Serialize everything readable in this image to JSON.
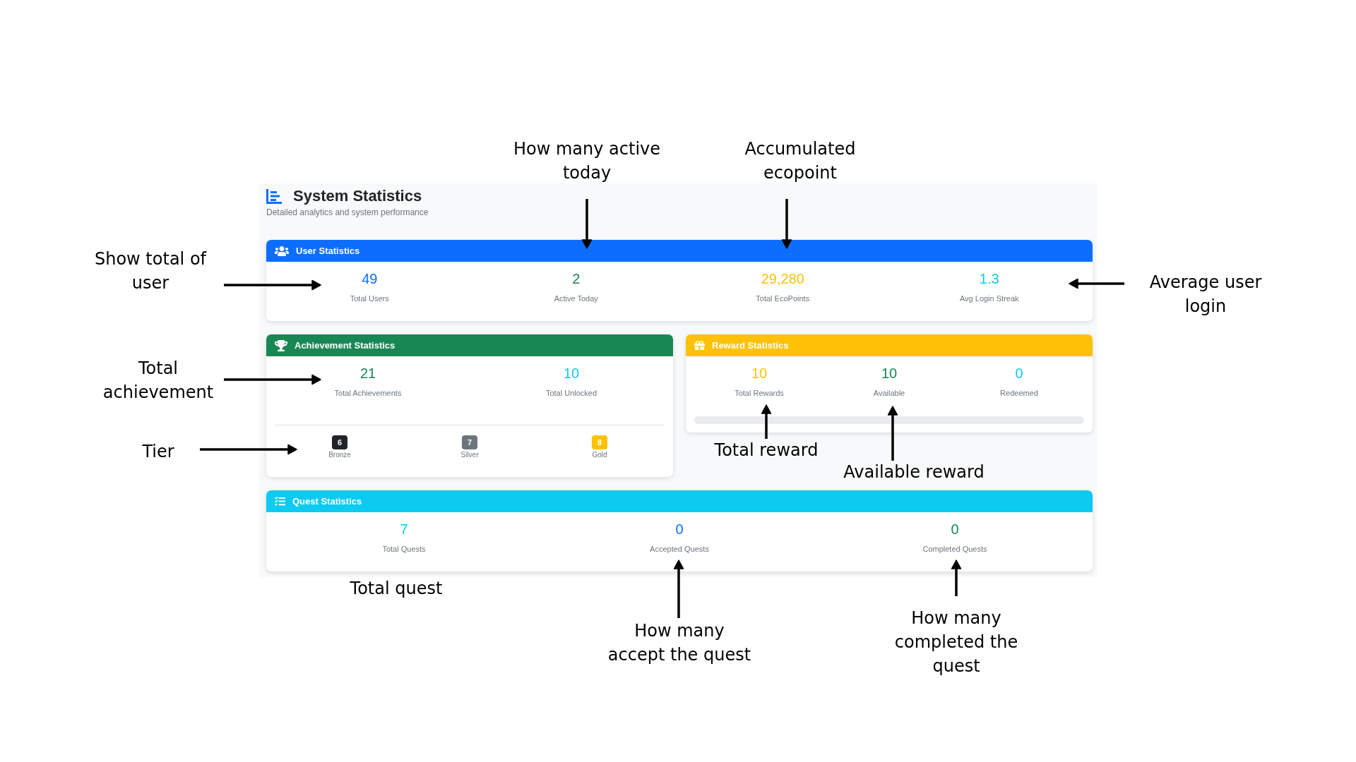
{
  "header": {
    "title": "System Statistics",
    "subtitle": "Detailed analytics and system performance"
  },
  "sections": [
    {
      "kind": "user",
      "title": "User Statistics",
      "color": "#0d6efd",
      "stats": [
        {
          "value": "49",
          "label": "Total Users",
          "color": "#0d6efd"
        },
        {
          "value": "2",
          "label": "Active Today",
          "color": "#198754"
        },
        {
          "value": "29,280",
          "label": "Total EcoPoints",
          "color": "#ffc107"
        },
        {
          "value": "1.3",
          "label": "Avg Login Streak",
          "color": "#0dcaf0"
        }
      ]
    },
    {
      "kind": "achievement",
      "title": "Achievement Statistics",
      "color": "#198754",
      "stats": [
        {
          "value": "21",
          "label": "Total Achievements",
          "color": "#198754"
        },
        {
          "value": "10",
          "label": "Total Unlocked",
          "color": "#0dcaf0"
        }
      ],
      "tiers": [
        {
          "count": "6",
          "label": "Bronze",
          "color": "#212529"
        },
        {
          "count": "7",
          "label": "Silver",
          "color": "#6c757d"
        },
        {
          "count": "8",
          "label": "Gold",
          "color": "#ffc107"
        }
      ]
    },
    {
      "kind": "reward",
      "title": "Reward Statistics",
      "color": "#ffc107",
      "stats": [
        {
          "value": "10",
          "label": "Total Rewards",
          "color": "#ffc107"
        },
        {
          "value": "10",
          "label": "Available",
          "color": "#198754"
        },
        {
          "value": "0",
          "label": "Redeemed",
          "color": "#0dcaf0"
        }
      ],
      "progress": {
        "level": 0
      }
    },
    {
      "kind": "quest",
      "title": "Quest Statistics",
      "color": "#0dcaf0",
      "stats": [
        {
          "value": "7",
          "label": "Total Quests",
          "color": "#0dcaf0"
        },
        {
          "value": "0",
          "label": "Accepted Quests",
          "color": "#0d6efd"
        },
        {
          "value": "0",
          "label": "Completed Quests",
          "color": "#198754"
        }
      ]
    }
  ],
  "annotations": [
    {
      "text": "How many active today"
    },
    {
      "text": "Accumulated ecopoint"
    },
    {
      "text": "Show total of user"
    },
    {
      "text": "Average user login"
    },
    {
      "text": "Total achievement"
    },
    {
      "text": "Tier"
    },
    {
      "text": "Total reward"
    },
    {
      "text": "Available reward"
    },
    {
      "text": "Total quest"
    },
    {
      "text": "How many accept the quest"
    },
    {
      "text": "How many completed the quest"
    }
  ]
}
